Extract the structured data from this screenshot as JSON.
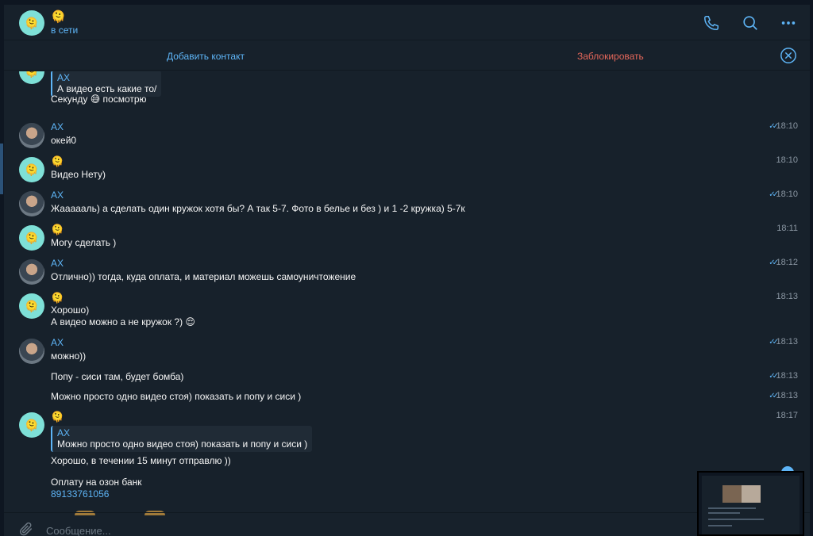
{
  "header": {
    "contact_name": "🫠",
    "status": "в сети",
    "avatar_emoji": "🫠",
    "icons": [
      "phone-icon",
      "search-icon",
      "more-icon"
    ]
  },
  "action_bar": {
    "add_contact": "Добавить контакт",
    "block": "Заблокировать"
  },
  "messages": [
    {
      "quote_name": "AX",
      "quote_text": "А видео есть какие то/",
      "text": "Секунду 😅 посмотрю"
    },
    {
      "sender": "AX",
      "text": "окей0",
      "time": "18:10",
      "read": "✓✓"
    },
    {
      "sender": "🫠",
      "text": "Видео Нету)",
      "time": "18:10"
    },
    {
      "sender": "AX",
      "text": "Жаааааль) а сделать один кружок хотя бы? А так 5-7. Фото в белье и без ) и 1 -2 кружка) 5-7к",
      "time": "18:10",
      "read": "✓✓"
    },
    {
      "sender": "🫠",
      "text": "Могу сделать )",
      "time": "18:11"
    },
    {
      "sender": "AX",
      "text": "Отлично)) тогда, куда оплата, и материал можешь самоуничтожение",
      "time": "18:12",
      "read": "✓✓"
    },
    {
      "sender": "🫠",
      "text_line1": "Хорошо)",
      "text_line2": "А видео можно а не кружок ?) 😌",
      "time": "18:13"
    },
    {
      "sender": "AX",
      "text": "можно))",
      "time": "18:13",
      "read": "✓✓"
    },
    {
      "text": "Попу - сиси там, будет бомба)",
      "time": "18:13",
      "read": "✓✓"
    },
    {
      "text": "Можно просто одно видео стоя) показать и попу и сиси )",
      "time": "18:13",
      "read": "✓✓"
    },
    {
      "sender": "🫠",
      "time": "18:17",
      "quote_name": "AX",
      "quote_text": "Можно просто одно видео стоя) показать и попу и сиси )",
      "text": "Хорошо, в течении 15 минут отправлю ))"
    },
    {
      "text": "Оплату на озон банк",
      "link": "89133761056"
    }
  ],
  "composer": {
    "placeholder": "Сообщение...",
    "attach_icon": "paperclip-icon"
  },
  "colors": {
    "background": "#17212b",
    "accent": "#5eb5f7",
    "danger": "#e5675a",
    "text": "#f5f5f5",
    "muted": "#8b97a3"
  }
}
